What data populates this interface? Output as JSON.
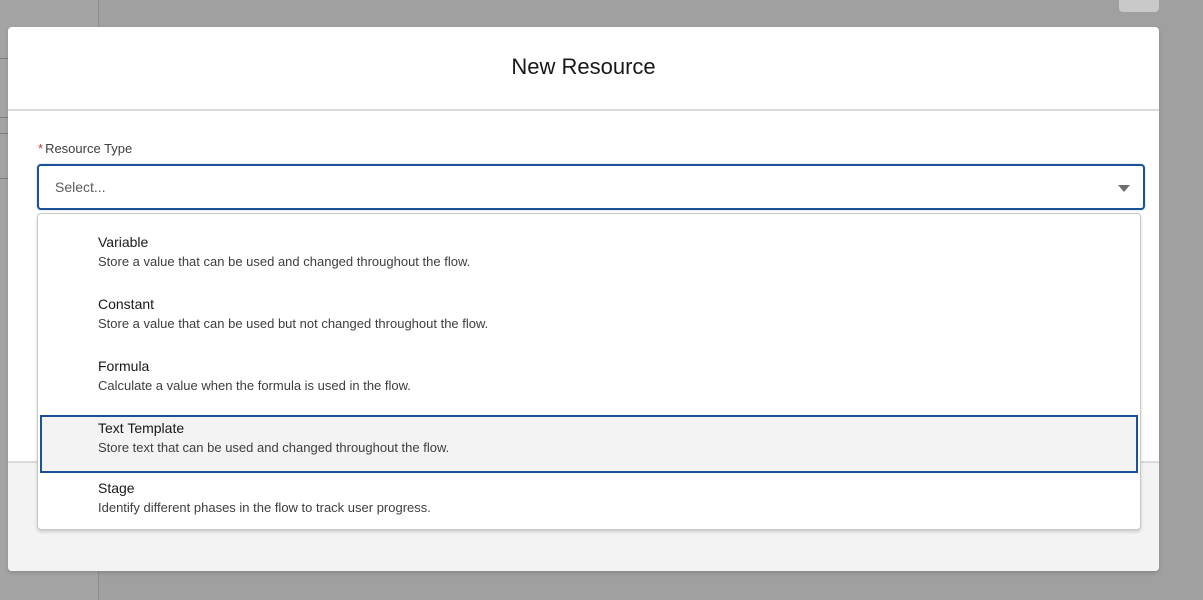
{
  "modal": {
    "title": "New Resource"
  },
  "field": {
    "required_marker": "*",
    "label": "Resource Type",
    "placeholder": "Select..."
  },
  "options": [
    {
      "title": "Variable",
      "description": "Store a value that can be used and changed throughout the flow."
    },
    {
      "title": "Constant",
      "description": "Store a value that can be used but not changed throughout the flow."
    },
    {
      "title": "Formula",
      "description": "Calculate a value when the formula is used in the flow."
    },
    {
      "title": "Text Template",
      "description": "Store text that can be used and changed throughout the flow."
    },
    {
      "title": "Stage",
      "description": "Identify different phases in the flow to track user progress."
    }
  ],
  "focused_option": "Text Template",
  "colors": {
    "focus_border": "#1b5297",
    "required": "#c23934",
    "overlay": "#a0a0a0"
  },
  "icons": {
    "combobox_arrow": "caret-down-icon"
  }
}
